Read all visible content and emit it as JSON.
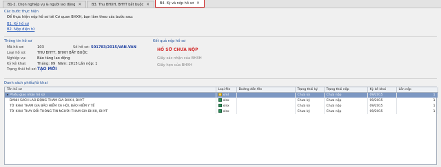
{
  "tabs": [
    {
      "label": "B1-2. Chọn nghiệp vụ & người lao động",
      "active": false
    },
    {
      "label": "B3. Thu BHXH, BHYT bắt buộc",
      "active": false
    },
    {
      "label": "B4. Ký và nộp hồ sơ",
      "active": true
    }
  ],
  "steps": {
    "title": "Các bước thực hiện",
    "intro": "Để thực hiện nộp hồ sơ tới Cơ quan BHXH, bạn làm theo các bước sau:",
    "links": [
      "B1. Ký hồ sơ",
      "B2. Nộp điện tử"
    ]
  },
  "info": {
    "title": "Thông tin hồ sơ",
    "ma_ho_so_label": "Mã hồ sơ:",
    "ma_ho_so": "103",
    "so_ho_so_label": "Số hồ sơ:",
    "so_ho_so": "501783/2015/VAN.VAN",
    "loai_ho_so_label": "Loại hồ sơ:",
    "loai_ho_so": "THU BHYT, BHXH BẮT BUỘC",
    "nghiep_vu_label": "Nghiệp vụ:",
    "nghiep_vu": "Báo tăng lao động",
    "ky_ke_khai_label": "Kỳ kê khai:",
    "thang_label": "Tháng: 09",
    "nam_label": "Năm: 2015",
    "lan_nop_label": "Lần nộp: 1",
    "trang_thai_label": "Trạng thái hồ sơ:",
    "trang_thai": "TẠO MỚI"
  },
  "result": {
    "title": "Kết quả nộp hồ sơ",
    "status": "HỒ SƠ CHƯA NỘP",
    "note1": "Giấy xác nhận của BHXH",
    "note2": "Giấy hẹn của BHXH"
  },
  "list": {
    "title": "Danh sách phiếu/tờ khai",
    "columns": [
      "Tên hồ sơ",
      "Loại file",
      "Đường dẫn file",
      "Trạng thái ký",
      "Trạng thái nộp",
      "Kỳ kê khai",
      "Lần nộp"
    ],
    "rows": [
      {
        "name": "Phiếu giao nhận hồ sơ",
        "type": "xml",
        "path": "",
        "sign": "Chưa ký",
        "submit": "Chưa nộp",
        "period": "09/2015",
        "times": "1",
        "selected": true,
        "expand": "▸"
      },
      {
        "name": "DANH SÁCH LAO ĐỘNG THAM GIA BHXH, BHYT",
        "type": "xlsx",
        "path": "",
        "sign": "Chưa ký",
        "submit": "Chưa nộp",
        "period": "09/2015",
        "times": "1",
        "selected": false,
        "expand": ""
      },
      {
        "name": "TỜ KHAI THAM GIA BẢO HIỂM XÃ HỘI, BẢO HIỂM Y TẾ",
        "type": "xlsx",
        "path": "",
        "sign": "Chưa ký",
        "submit": "Chưa nộp",
        "period": "09/2015",
        "times": "1",
        "selected": false,
        "expand": ""
      },
      {
        "name": "TỜ KHAI THAY ĐỔI THÔNG TIN NGƯỜI THAM GIA BHXH, BHYT",
        "type": "xlsx",
        "path": "",
        "sign": "Chưa ký",
        "submit": "Chưa nộp",
        "period": "09/2015",
        "times": "1",
        "selected": false,
        "expand": ""
      }
    ]
  }
}
